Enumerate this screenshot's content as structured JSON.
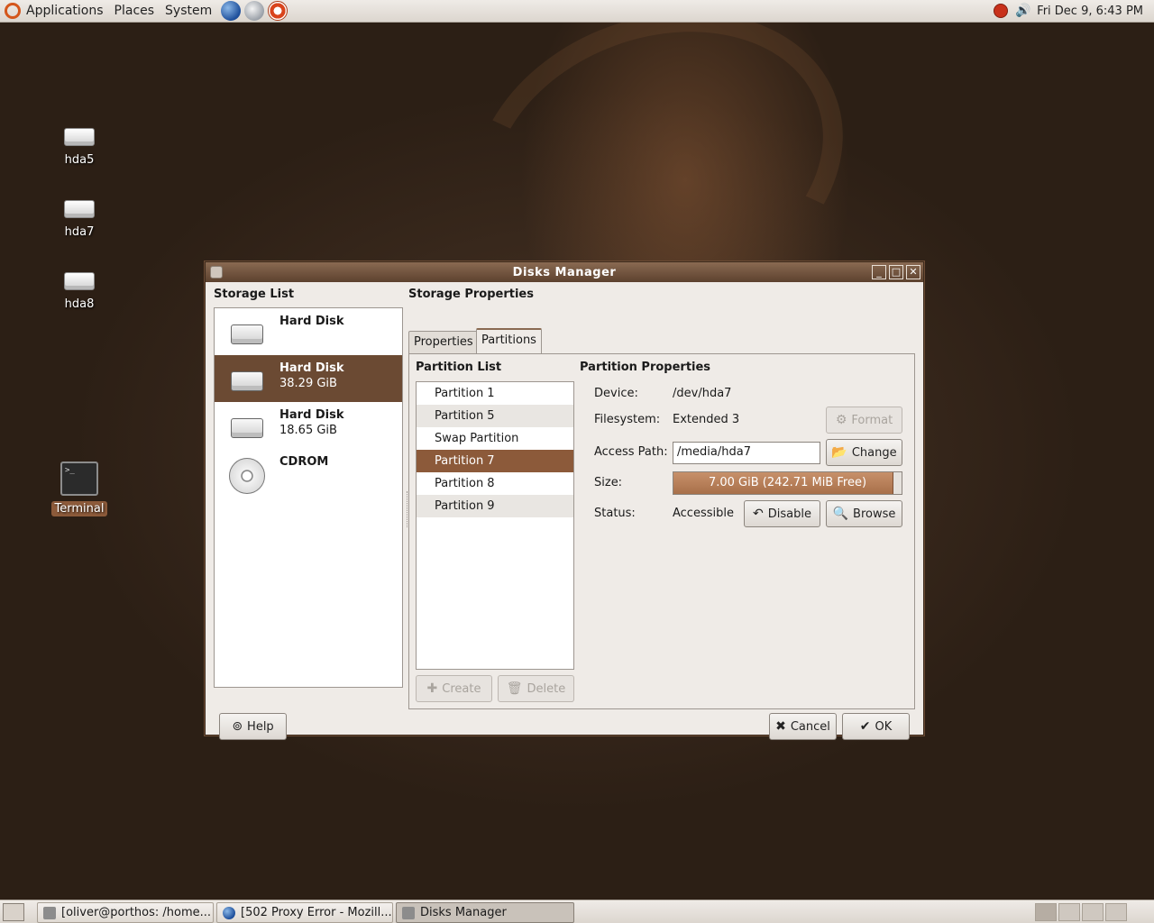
{
  "top_panel": {
    "menus": [
      "Applications",
      "Places",
      "System"
    ],
    "clock": "Fri Dec  9,  6:43 PM"
  },
  "desktop_icons": [
    {
      "label": "hda5"
    },
    {
      "label": "hda7"
    },
    {
      "label": "hda8"
    },
    {
      "label": "Terminal"
    }
  ],
  "window": {
    "title": "Disks Manager",
    "storage_list_label": "Storage List",
    "storage_items": [
      {
        "name": "Hard Disk",
        "size": "",
        "icon": "hard-disk-icon"
      },
      {
        "name": "Hard Disk",
        "size": "38.29 GiB",
        "icon": "hard-disk-icon"
      },
      {
        "name": "Hard Disk",
        "size": "18.65 GiB",
        "icon": "hard-disk-icon"
      },
      {
        "name": "CDROM",
        "size": "",
        "icon": "cdrom-icon"
      }
    ],
    "selected_storage": 1,
    "storage_properties_label": "Storage Properties",
    "tabs": [
      {
        "label": "Properties",
        "active": false
      },
      {
        "label": "Partitions",
        "active": true
      }
    ],
    "partition_list_label": "Partition List",
    "partitions": [
      "Partition 1",
      "Partition 5",
      "Swap Partition",
      "Partition 7",
      "Partition 8",
      "Partition 9"
    ],
    "selected_partition": 3,
    "create_label": "Create",
    "delete_label": "Delete",
    "partition_properties_label": "Partition Properties",
    "device_label": "Device:",
    "device_value": "/dev/hda7",
    "filesystem_label": "Filesystem:",
    "filesystem_value": "Extended 3",
    "format_label": "Format",
    "access_path_label": "Access Path:",
    "access_path_value": "/media/hda7",
    "change_label": "Change",
    "size_label": "Size:",
    "size_text": "7.00 GiB (242.71 MiB Free)",
    "size_used_fraction": 0.966,
    "status_label": "Status:",
    "status_value": "Accessible",
    "disable_label": "Disable",
    "browse_label": "Browse",
    "help_label": "Help",
    "cancel_label": "Cancel",
    "ok_label": "OK"
  },
  "taskbar": {
    "tasks": [
      {
        "label": "[oliver@porthos: /home...",
        "icon": "terminal-icon"
      },
      {
        "label": "[502 Proxy Error - Mozill...",
        "icon": "browser-icon"
      },
      {
        "label": "Disks Manager",
        "icon": "disks-icon"
      }
    ]
  },
  "colors": {
    "selection": "#6b4a33",
    "partition_selection": "#8c5a3a",
    "titlebar": "#6e5040",
    "panel": "#e6e1dc"
  }
}
